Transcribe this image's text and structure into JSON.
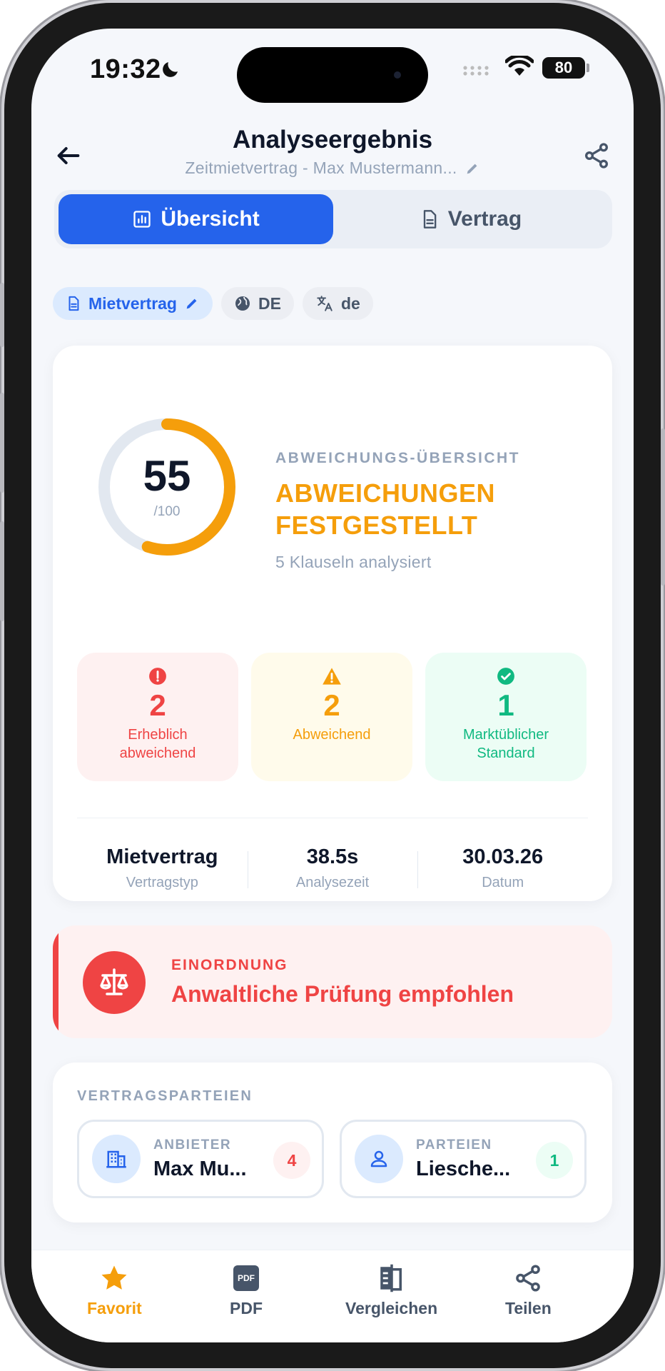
{
  "status_bar": {
    "time": "19:32",
    "battery": "80"
  },
  "header": {
    "title": "Analyseergebnis",
    "subtitle": "Zeitmietvertrag - Max Mustermann..."
  },
  "tabs": [
    {
      "label": "Übersicht",
      "active": true
    },
    {
      "label": "Vertrag",
      "active": false
    }
  ],
  "chips": [
    {
      "label": "Mietvertrag",
      "icon": "document-icon"
    },
    {
      "label": "DE",
      "icon": "globe-icon"
    },
    {
      "label": "de",
      "icon": "translate-icon"
    }
  ],
  "summary": {
    "score": "55",
    "score_max": "/100",
    "score_fraction": 0.55,
    "overline": "ABWEICHUNGS-ÜBERSICHT",
    "status_title": "ABWEICHUNGEN FESTGESTELLT",
    "clauses": "5 Klauseln analysiert",
    "tiles": [
      {
        "count": "2",
        "label": "Erheblich abweichend",
        "color": "#ef4444"
      },
      {
        "count": "2",
        "label": "Abweichend",
        "color": "#f59e0b"
      },
      {
        "count": "1",
        "label": "Marktüblicher Standard",
        "color": "#10b981"
      }
    ],
    "stats": [
      {
        "value": "Mietvertrag",
        "label": "Vertragstyp"
      },
      {
        "value": "38.5s",
        "label": "Analysezeit"
      },
      {
        "value": "30.03.26",
        "label": "Datum"
      }
    ]
  },
  "classification": {
    "overline": "EINORDNUNG",
    "title": "Anwaltliche Prüfung empfohlen"
  },
  "parties": {
    "title": "VERTRAGSPARTEIEN",
    "items": [
      {
        "role": "ANBIETER",
        "name": "Max Mu...",
        "count": "4"
      },
      {
        "role": "PARTEIEN",
        "name": "Liesche...",
        "count": "1"
      }
    ]
  },
  "bottom_nav": [
    {
      "label": "Favorit",
      "active": true
    },
    {
      "label": "PDF",
      "icon_text": "PDF"
    },
    {
      "label": "Vergleichen"
    },
    {
      "label": "Teilen"
    }
  ],
  "colors": {
    "primary": "#2563eb",
    "warning": "#f59e0b",
    "danger": "#ef4444",
    "success": "#10b981"
  }
}
